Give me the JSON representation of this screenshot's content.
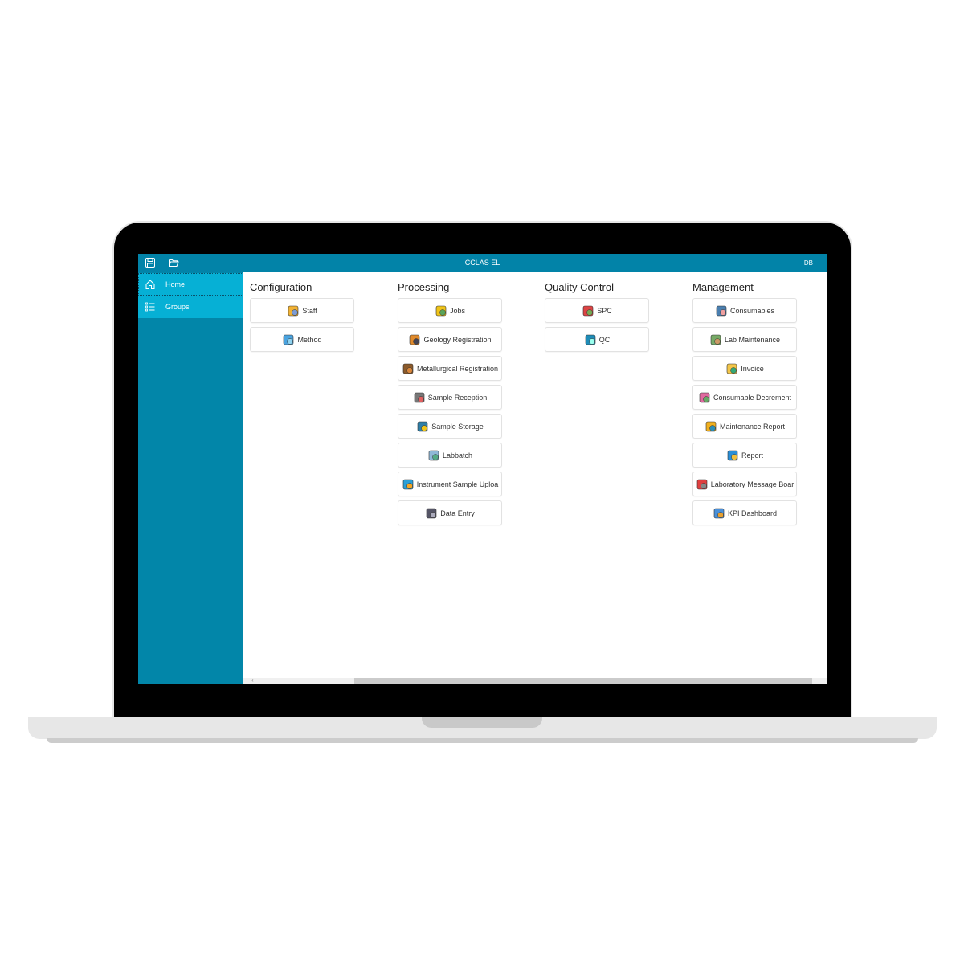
{
  "app": {
    "title": "CCLAS EL",
    "user_initials": "DB"
  },
  "toolbar": {
    "icons": [
      "save-icon",
      "open-folder-icon"
    ]
  },
  "sidebar": {
    "items": [
      {
        "label": "Home",
        "icon": "home-icon",
        "active": true
      },
      {
        "label": "Groups",
        "icon": "list-icon",
        "active": false
      }
    ]
  },
  "groups": [
    {
      "title": "Configuration",
      "tiles": [
        {
          "label": "Staff",
          "icon": "staff-icon"
        },
        {
          "label": "Method",
          "icon": "method-flask-icon"
        }
      ]
    },
    {
      "title": "Processing",
      "tiles": [
        {
          "label": "Jobs",
          "icon": "jobs-folder-icon"
        },
        {
          "label": "Geology Registration",
          "icon": "pickaxe-icon"
        },
        {
          "label": "Metallurgical Registration",
          "icon": "factory-icon"
        },
        {
          "label": "Sample Reception",
          "icon": "clipboard-pencil-icon"
        },
        {
          "label": "Sample Storage",
          "icon": "warehouse-icon"
        },
        {
          "label": "Labbatch",
          "icon": "labbatch-clipboard-icon"
        },
        {
          "label": "Instrument Sample Uploa",
          "icon": "upload-icon"
        },
        {
          "label": "Data Entry",
          "icon": "keyboard-icon"
        }
      ]
    },
    {
      "title": "Quality Control",
      "tiles": [
        {
          "label": "SPC",
          "icon": "spc-chart-icon"
        },
        {
          "label": "QC",
          "icon": "qc-chart-icon"
        }
      ]
    },
    {
      "title": "Management",
      "tiles": [
        {
          "label": "Consumables",
          "icon": "bottle-icon"
        },
        {
          "label": "Lab Maintenance",
          "icon": "calendar-wrench-icon"
        },
        {
          "label": "Invoice",
          "icon": "envelope-icon"
        },
        {
          "label": "Consumable Decrement",
          "icon": "notebook-flask-icon"
        },
        {
          "label": "Maintenance Report",
          "icon": "report-gear-icon"
        },
        {
          "label": "Report",
          "icon": "report-icon"
        },
        {
          "label": "Laboratory Message Boar",
          "icon": "megaphone-icon"
        },
        {
          "label": "KPI Dashboard",
          "icon": "dashboard-monitor-icon"
        }
      ]
    }
  ],
  "colors": {
    "titlebar": "#0283a8",
    "sidebar": "#0286a9",
    "sidebar_item": "#06b0d5"
  }
}
